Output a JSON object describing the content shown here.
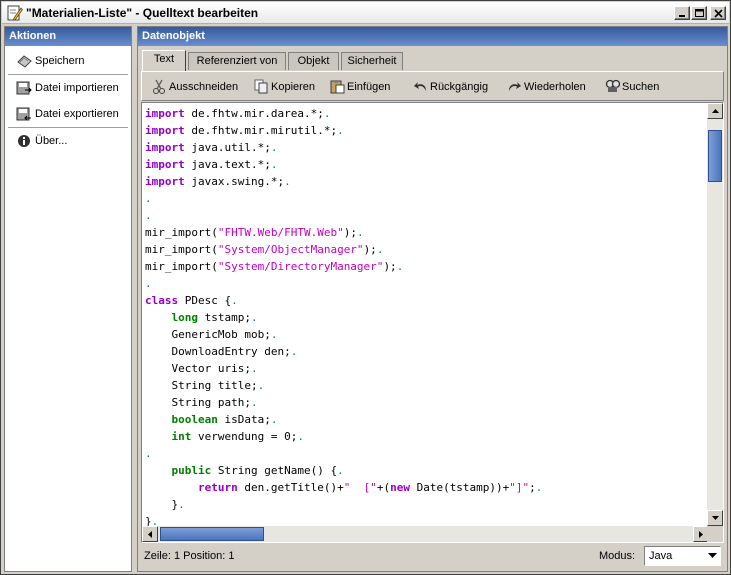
{
  "window": {
    "title": "\"Materialien-Liste\" - Quelltext bearbeiten"
  },
  "left_panel": {
    "header": "Aktionen",
    "items": [
      {
        "label": "Speichern",
        "icon": "save-icon"
      },
      {
        "label": "Datei importieren",
        "icon": "import-icon"
      },
      {
        "label": "Datei exportieren",
        "icon": "export-icon"
      },
      {
        "label": "Über...",
        "icon": "info-icon"
      }
    ]
  },
  "right_panel": {
    "header": "Datenobjekt",
    "tabs": [
      "Text",
      "Referenziert von",
      "Objekt",
      "Sicherheit"
    ],
    "active_tab": "Text",
    "toolbar": [
      "Ausschneiden",
      "Kopieren",
      "Einfügen",
      "Rückgängig",
      "Wiederholen",
      "Suchen"
    ]
  },
  "editor": {
    "lines": [
      "import de.fhtw.mir.darea.*;",
      "import de.fhtw.mir.mirutil.*;",
      "import java.util.*;",
      "import java.text.*;",
      "import javax.swing.*;",
      "",
      "",
      "mir_import(\"FHTW.Web/FHTW.Web\");",
      "mir_import(\"System/ObjectManager\");",
      "mir_import(\"System/DirectoryManager\");",
      "",
      "class PDesc {",
      "    long tstamp;",
      "    GenericMob mob;",
      "    DownloadEntry den;",
      "    Vector uris;",
      "    String title;",
      "    String path;",
      "    boolean isData;",
      "    int verwendung = 0;",
      "",
      "    public String getName() {",
      "        return den.getTitle()+\"  [\"+(new Date(tstamp))+\"]\";",
      "    }",
      "}"
    ]
  },
  "status": {
    "position_text": "Zeile: 1 Position: 1",
    "mode_label": "Modus:",
    "mode_value": "Java"
  },
  "colors": {
    "keyword": "#9400c8",
    "type_keyword": "#008000",
    "string": "#c300c3",
    "header_gradient_start": "#335a9e"
  }
}
